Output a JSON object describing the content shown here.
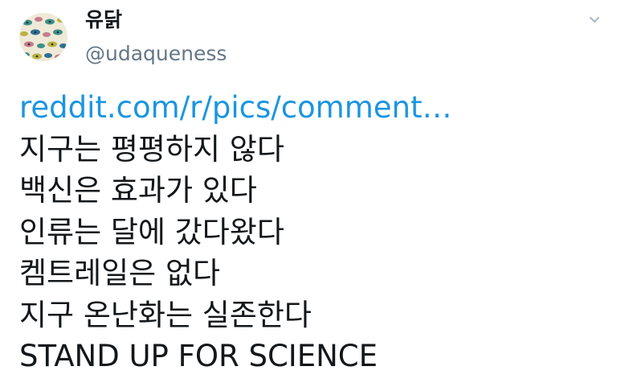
{
  "user": {
    "display_name": "유닭",
    "handle": "@udaqueness"
  },
  "menu": {
    "caret_icon": "chevron-down-icon"
  },
  "tweet": {
    "link_text": "reddit.com/r/pics/comment…",
    "lines": [
      "지구는 평평하지 않다",
      "백신은 효과가 있다",
      "인류는 달에 갔다왔다",
      "켐트레일은 없다",
      "지구 온난화는 실존한다",
      "STAND UP FOR SCIENCE"
    ]
  },
  "colors": {
    "link": "#1b95e0",
    "text": "#14171a",
    "handle": "#657786",
    "caret": "#aab8c2"
  }
}
